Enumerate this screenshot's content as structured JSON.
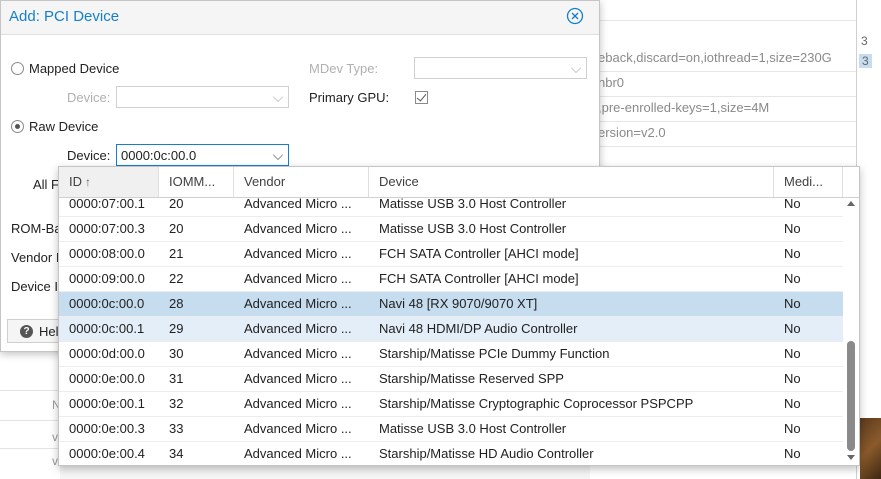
{
  "background": {
    "rows": [
      "eback,discard=on,iothread=1,size=230G",
      "nbr0",
      ",pre-enrolled-keys=1,size=4M",
      "ersion=v2.0"
    ],
    "scroll_numbers": [
      "3",
      "3"
    ],
    "lower_letters": [
      "N",
      "v",
      "v"
    ]
  },
  "dialog": {
    "title": "Add: PCI Device",
    "mapped_device_label": "Mapped Device",
    "raw_device_label": "Raw Device",
    "device_label": "Device:",
    "mapped_device_value": "",
    "raw_device_value": "0000:0c:00.0",
    "mdev_type_label": "MDev Type:",
    "primary_gpu_label": "Primary GPU:",
    "primary_gpu_checked": true,
    "all_functions_label": "All F",
    "rom_bar_label": "ROM-Ba",
    "vendor_label": "Vendor I",
    "device_id_label": "Device I",
    "help_button_label": "Help"
  },
  "picker": {
    "columns": [
      "ID",
      "IOMM...",
      "Vendor",
      "Device",
      "Medi..."
    ],
    "sort_column": "ID",
    "sort_direction": "ascending",
    "rows": [
      {
        "id": "0000:07:00.1",
        "iommu": "20",
        "vendor": "Advanced Micro ...",
        "device": "Matisse USB 3.0 Host Controller",
        "mdev": "No"
      },
      {
        "id": "0000:07:00.3",
        "iommu": "20",
        "vendor": "Advanced Micro ...",
        "device": "Matisse USB 3.0 Host Controller",
        "mdev": "No"
      },
      {
        "id": "0000:08:00.0",
        "iommu": "21",
        "vendor": "Advanced Micro ...",
        "device": "FCH SATA Controller [AHCI mode]",
        "mdev": "No"
      },
      {
        "id": "0000:09:00.0",
        "iommu": "22",
        "vendor": "Advanced Micro ...",
        "device": "FCH SATA Controller [AHCI mode]",
        "mdev": "No"
      },
      {
        "id": "0000:0c:00.0",
        "iommu": "28",
        "vendor": "Advanced Micro ...",
        "device": "Navi 48 [RX 9070/9070 XT]",
        "mdev": "No"
      },
      {
        "id": "0000:0c:00.1",
        "iommu": "29",
        "vendor": "Advanced Micro ...",
        "device": "Navi 48 HDMI/DP Audio Controller",
        "mdev": "No"
      },
      {
        "id": "0000:0d:00.0",
        "iommu": "30",
        "vendor": "Advanced Micro ...",
        "device": "Starship/Matisse PCIe Dummy Function",
        "mdev": "No"
      },
      {
        "id": "0000:0e:00.0",
        "iommu": "31",
        "vendor": "Advanced Micro ...",
        "device": "Starship/Matisse Reserved SPP",
        "mdev": "No"
      },
      {
        "id": "0000:0e:00.1",
        "iommu": "32",
        "vendor": "Advanced Micro ...",
        "device": "Starship/Matisse Cryptographic Coprocessor PSPCPP",
        "mdev": "No"
      },
      {
        "id": "0000:0e:00.3",
        "iommu": "33",
        "vendor": "Advanced Micro ...",
        "device": "Matisse USB 3.0 Host Controller",
        "mdev": "No"
      },
      {
        "id": "0000:0e:00.4",
        "iommu": "34",
        "vendor": "Advanced Micro ...",
        "device": "Starship/Matisse HD Audio Controller",
        "mdev": "No"
      }
    ],
    "selected_id": "0000:0c:00.0",
    "hover_id": "0000:0c:00.1"
  },
  "colors": {
    "accent": "#157fcc",
    "selected_row": "#c6dcef",
    "hover_row": "#e3eef8"
  },
  "icons": {
    "close": "close-circle-icon",
    "help": "question-circle-icon",
    "sort": "arrow-up-icon",
    "dropdown": "chevron-down-icon"
  }
}
